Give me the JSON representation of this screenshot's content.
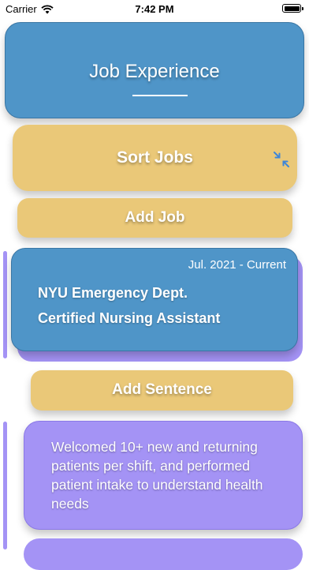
{
  "status_bar": {
    "carrier": "Carrier",
    "time": "7:42 PM"
  },
  "header": {
    "title": "Job Experience"
  },
  "sort_button": {
    "label": "Sort Jobs",
    "icon": "compress-arrows-icon"
  },
  "add_job_button": {
    "label": "Add Job"
  },
  "job": {
    "date_range": "Jul. 2021 - Current",
    "employer": "NYU Emergency Dept.",
    "position": "Certified Nursing Assistant"
  },
  "add_sentence_button": {
    "label": "Add Sentence"
  },
  "sentences": [
    {
      "text": "Welcomed 10+ new and returning patients per shift, and performed patient intake to understand health needs"
    }
  ],
  "colors": {
    "blue": "#4f95c8",
    "yellow": "#eac878",
    "purple": "#a493f5"
  }
}
